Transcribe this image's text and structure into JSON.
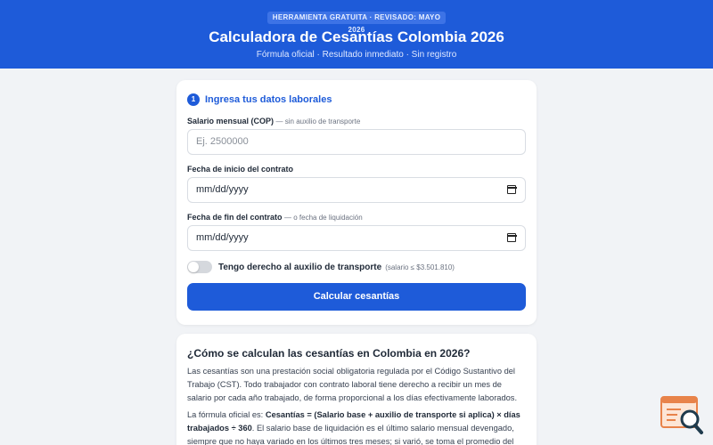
{
  "header": {
    "badge": "HERRAMIENTA GRATUITA · REVISADO: MAYO 2026",
    "title": "Calculadora de Cesantías Colombia 2026",
    "subtitle": "Fórmula oficial · Resultado inmediato · Sin registro"
  },
  "form": {
    "step_number": "1",
    "step_title": "Ingresa tus datos laborales",
    "salary": {
      "label": "Salario mensual (COP)",
      "hint": "— sin auxilio de transporte",
      "placeholder": "Ej. 2500000"
    },
    "start_date": {
      "label": "Fecha de inicio del contrato",
      "value": "mm/dd/yyyy"
    },
    "end_date": {
      "label": "Fecha de fin del contrato",
      "hint": "— o fecha de liquidación",
      "value": "mm/dd/yyyy"
    },
    "transport_toggle": {
      "label": "Tengo derecho al auxilio de transporte",
      "hint": "(salario ≤ $3.501.810)"
    },
    "submit_label": "Calcular cesantías"
  },
  "info": {
    "title": "¿Cómo se calculan las cesantías en Colombia en 2026?",
    "paragraph1": "Las cesantías son una prestación social obligatoria regulada por el Código Sustantivo del Trabajo (CST). Todo trabajador con contrato laboral tiene derecho a recibir un mes de salario por cada año trabajado, de forma proporcional a los días efectivamente laborados.",
    "p2_intro": "La fórmula oficial es: ",
    "p2_formula": "Cesantías = (Salario base + auxilio de transporte si aplica) × días trabajados ÷ 360",
    "p2_rest": ". El salario base de liquidación es el último salario mensual devengado, siempre que no haya variado en los últimos tres meses; si varió, se toma el promedio del"
  },
  "colors": {
    "primary": "#1e5bd9",
    "background": "#f1f3f6"
  },
  "icons": {
    "calendar": "calendar-icon",
    "assistant": "search-document-icon"
  }
}
